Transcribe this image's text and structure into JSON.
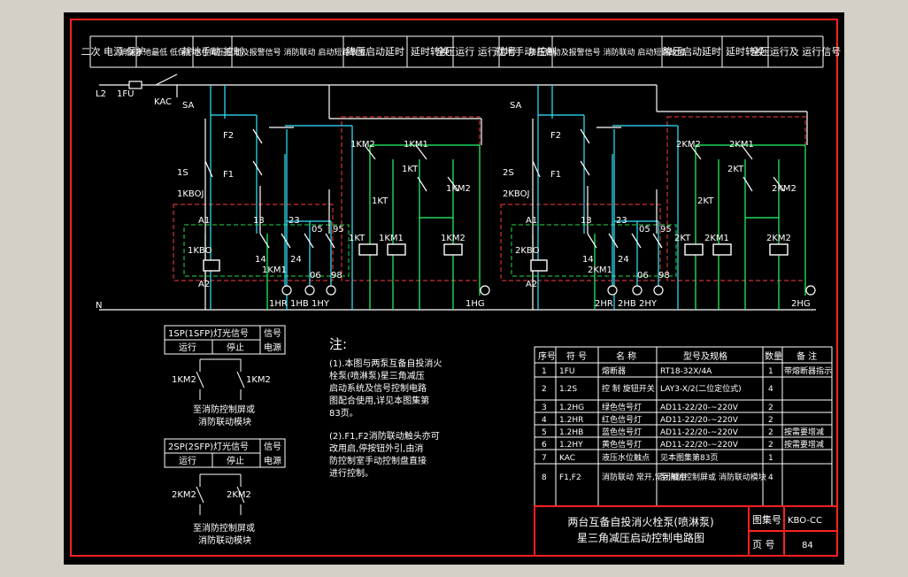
{
  "colors": {
    "background": "#000000",
    "frame": "#ff2020",
    "wire": "#ffffff",
    "green": "#22ff66",
    "cyan": "#33e8ff",
    "dash_red": "#ff3b3b",
    "dash_green": "#22dd44",
    "text": "#ffffff",
    "outer": "#d4d0c8"
  },
  "header": [
    "二次 电源 保护",
    "消防水池最低 低保护水位",
    "就地手动 控制",
    "降压启动及报警信号 消防联动 启动短路故障",
    "降压启动延时",
    "延时转换",
    "全压运行 运行信号",
    "就地手动 控制",
    "降压启动及报警信号 消防联动 启动短路故障",
    "降压启动延时",
    "延时转换",
    "全压运行及 运行信号"
  ],
  "labels": {
    "L2": "L2",
    "FU": "1FU",
    "KAC": "KAC",
    "N": "N",
    "SA1": "SA",
    "SA2": "SA",
    "F2a": "F2",
    "F1a": "F1",
    "F2b": "F2",
    "F1b": "F1",
    "S1": "1S",
    "S2": "2S",
    "KBOJ1": "1KBOJ",
    "KBOJ2": "2KBOJ",
    "KBO1": "1KBO",
    "KBO2": "2KBO",
    "A1a": "A1",
    "A2a": "A2",
    "A1b": "A1",
    "A2b": "A2",
    "n13a": "13",
    "n14a": "14",
    "n23a": "23",
    "n24a": "24",
    "n05a": "05",
    "n06a": "06",
    "n95a": "95",
    "n98a": "98",
    "n13b": "13",
    "n14b": "14",
    "n23b": "23",
    "n24b": "24",
    "n05b": "05",
    "n06b": "06",
    "n95b": "95",
    "n98b": "98",
    "KM1a": "1KM1",
    "KM1b": "2KM1",
    "KM2c1": "1KM2",
    "KM1c1": "1KM1",
    "KTc1": "1KT",
    "KTd1": "1KT",
    "KM2d1": "1KM2",
    "KM2c2": "2KM2",
    "KM1c2": "2KM1",
    "KTc2": "2KT",
    "KTd2": "2KT",
    "KM2d2": "2KM2",
    "coilKT1": "1KT",
    "coilKM1a": "1KM1",
    "coilKM2a": "1KM2",
    "coilKT2": "2KT",
    "coilKM1b": "2KM1",
    "coilKM2b": "2KM2",
    "HR1": "1HR",
    "HB1": "1HB",
    "HY1": "1HY",
    "HG1": "1HG",
    "HR2": "2HR",
    "HB2": "2HB",
    "HY2": "2HY",
    "HG2": "2HG"
  },
  "signal_box1": {
    "title": "1SP(1SFP)灯光信号",
    "col_run": "运行",
    "col_stop": "停止",
    "col_sig": "信号",
    "col_power": "电源",
    "c1": "1KM2",
    "c2": "1KM2",
    "note1": "至消防控制屏或",
    "note2": "消防联动模块"
  },
  "signal_box2": {
    "title": "2SP(2SFP)灯光信号",
    "col_run": "运行",
    "col_stop": "停止",
    "col_sig": "信号",
    "col_power": "电源",
    "c1": "2KM2",
    "c2": "2KM2",
    "note1": "至消防控制屏或",
    "note2": "消防联动模块"
  },
  "notes": {
    "title": "注:",
    "lines": [
      "(1).本图与两泵互备自投消火",
      "   栓泵(喷淋泵)星三角减压",
      "   启动系统及信号控制电路",
      "   图配合使用,详见本图集第",
      "   83页。",
      "(2).F1,F2消防联动触头亦可",
      "   改用启,停按钮外引,由消",
      "   防控制室手动控制盘直接",
      "   进行控制。"
    ]
  },
  "parts_table": {
    "headers": [
      "序号",
      "符 号",
      "名 称",
      "型号及规格",
      "数量",
      "备 注"
    ],
    "rows": [
      [
        "1",
        "1FU",
        "熔断器",
        "RT18-32X/4A",
        "1",
        "带熔断器指示"
      ],
      [
        "2",
        "1.2S",
        "控 制 旋钮开关",
        "LAY3-X/2(二位定位式)",
        "4",
        ""
      ],
      [
        "3",
        "1.2HG",
        "绿色信号灯",
        "AD11-22/20-~220V",
        "2",
        ""
      ],
      [
        "4",
        "1.2HR",
        "红色信号灯",
        "AD11-22/20-~220V",
        "2",
        ""
      ],
      [
        "5",
        "1.2HB",
        "蓝色信号灯",
        "AD11-22/20-~220V",
        "2",
        "按需要增减"
      ],
      [
        "6",
        "1.2HY",
        "黄色信号灯",
        "AD11-22/20-~220V",
        "2",
        "按需要增减"
      ],
      [
        "7",
        "KAC",
        "液压水位触点",
        "见本图集第83页",
        "1",
        ""
      ],
      [
        "8",
        "F1,F2",
        "消防联动 常开,常闭触点",
        "至消防控制屏或 消防联动模块",
        "4",
        ""
      ]
    ]
  },
  "title_block": {
    "title1": "两台互备自投消火栓泵(喷淋泵)",
    "title2": "星三角减压启动控制电路图",
    "atlas_label": "图集号",
    "atlas_value": "KBO-CC",
    "page_label": "页 号",
    "page_value": "84"
  }
}
